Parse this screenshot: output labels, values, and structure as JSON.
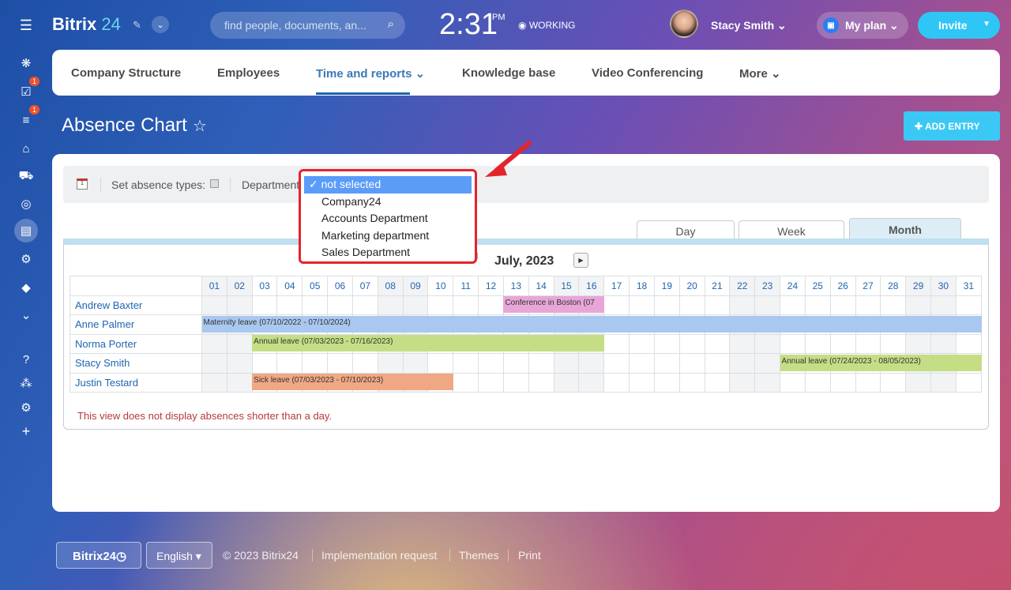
{
  "header": {
    "logo": "Bitrix",
    "logo_num": "24",
    "search_placeholder": "find people, documents, an...",
    "time": "2:31",
    "ampm": "PM",
    "status": "WORKING",
    "user_name": "Stacy Smith",
    "plan_label": "My plan",
    "invite_label": "Invite"
  },
  "left_nav": {
    "badges": [
      "1",
      "1"
    ]
  },
  "tabs": [
    "Company Structure",
    "Employees",
    "Time and reports",
    "Knowledge base",
    "Video Conferencing",
    "More"
  ],
  "page": {
    "title": "Absence Chart",
    "add_entry": "ADD ENTRY"
  },
  "filter": {
    "absence_types_label": "Set absence types:",
    "department_label": "Department",
    "options": [
      "not selected",
      "Company24",
      "Accounts Department",
      "Marketing department",
      "Sales Department"
    ],
    "selected": "not selected",
    "check": "✓"
  },
  "view_tabs": [
    "Day",
    "Week",
    "Month"
  ],
  "calendar": {
    "month_label": "July, 2023",
    "days": [
      "01",
      "02",
      "03",
      "04",
      "05",
      "06",
      "07",
      "08",
      "09",
      "10",
      "11",
      "12",
      "13",
      "14",
      "15",
      "16",
      "17",
      "18",
      "19",
      "20",
      "21",
      "22",
      "23",
      "24",
      "25",
      "26",
      "27",
      "28",
      "29",
      "30",
      "31"
    ],
    "weekend_days": [
      1,
      2,
      8,
      9,
      15,
      16,
      22,
      23,
      29,
      30
    ],
    "employees": [
      "Andrew Baxter",
      "Anne Palmer",
      "Norma Porter",
      "Stacy Smith",
      "Justin Testard"
    ],
    "absences": [
      {
        "row": 0,
        "start": 13,
        "end": 16,
        "label": "Conference in Boston (07",
        "color": "#e8a6d8"
      },
      {
        "row": 1,
        "start": 1,
        "end": 31,
        "label": "Maternity leave (07/10/2022 - 07/10/2024)",
        "color": "#a9c8f0"
      },
      {
        "row": 2,
        "start": 3,
        "end": 16,
        "label": "Annual leave (07/03/2023 - 07/16/2023)",
        "color": "#c5de86"
      },
      {
        "row": 3,
        "start": 24,
        "end": 31,
        "label": "Annual leave (07/24/2023 - 08/05/2023)",
        "color": "#c5de86"
      },
      {
        "row": 4,
        "start": 3,
        "end": 10,
        "label": "Sick leave (07/03/2023 - 07/10/2023)",
        "color": "#f0a884"
      }
    ],
    "note": "This view does not display absences shorter than a day."
  },
  "footer": {
    "logo": "Bitrix24",
    "language": "English",
    "copyright": "© 2023 Bitrix24",
    "links": [
      "Implementation request",
      "Themes",
      "Print"
    ]
  }
}
